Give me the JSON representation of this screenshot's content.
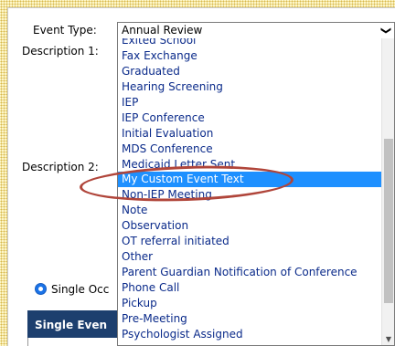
{
  "form": {
    "event_type_label": "Event Type:",
    "description1_label": "Description 1:",
    "description2_label": "Description 2:",
    "single_occurrence_label": "Single Occ",
    "section_header": "Single Even"
  },
  "event_type_select": {
    "value": "Annual Review",
    "arrow": "❯"
  },
  "dropdown": {
    "options": [
      "Exited School",
      "Fax Exchange",
      "Graduated",
      "Hearing Screening",
      "IEP",
      "IEP Conference",
      "Initial Evaluation",
      "MDS Conference",
      "Medicaid Letter Sent",
      "My Custom Event Text",
      "Non-IEP Meeting",
      "Note",
      "Observation",
      "OT referral initiated",
      "Other",
      "Parent Guardian Notification of Conference",
      "Phone Call",
      "Pickup",
      "Pre-Meeting",
      "Psychologist Assigned"
    ],
    "selected_index": 9,
    "scroll_down_arrow": "▼"
  },
  "colors": {
    "option_text": "#0a2a8a",
    "selected_bg": "#1e90ff",
    "annotation": "#b0453a",
    "header_bg": "#1d3f6e"
  }
}
